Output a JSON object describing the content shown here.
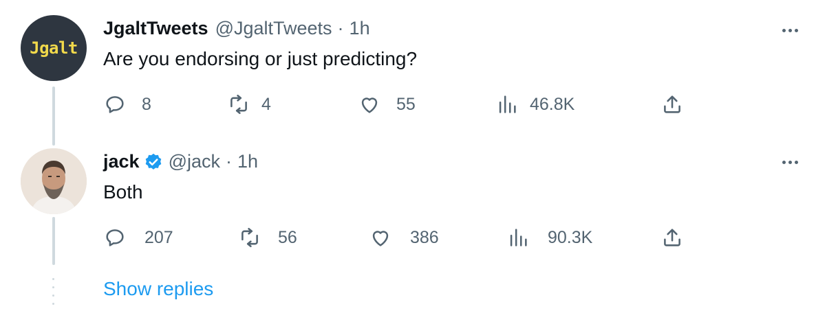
{
  "tweets": [
    {
      "avatar_text": "Jgalt",
      "name": "JgaltTweets",
      "handle": "@JgaltTweets",
      "sep": "·",
      "time": "1h",
      "text": "Are you endorsing or just predicting?",
      "replies": "8",
      "retweets": "4",
      "likes": "55",
      "views": "46.8K"
    },
    {
      "name": "jack",
      "handle": "@jack",
      "sep": "·",
      "time": "1h",
      "verified": true,
      "text": "Both",
      "replies": "207",
      "retweets": "56",
      "likes": "386",
      "views": "90.3K"
    }
  ],
  "show_replies": "Show replies",
  "colors": {
    "accent": "#1d9bf0",
    "muted": "#536471",
    "thread_line": "#cfd9de"
  }
}
